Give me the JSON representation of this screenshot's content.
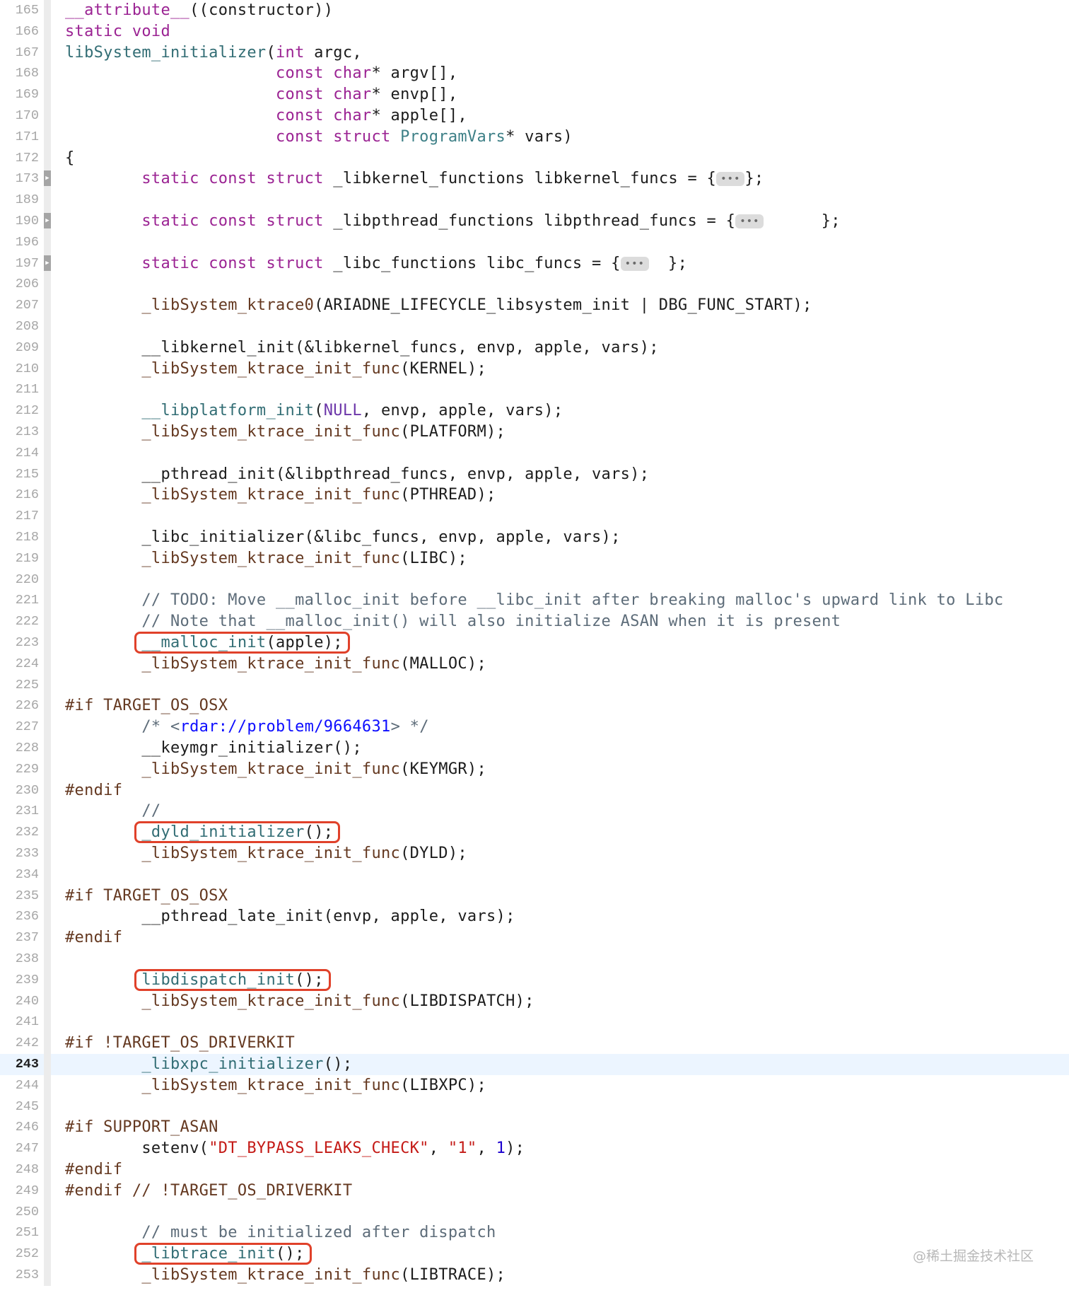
{
  "editor": {
    "current_line": "243",
    "lines": [
      {
        "num": "165",
        "tokens": [
          {
            "t": "__attribute__",
            "c": "k"
          },
          {
            "t": "((constructor))",
            "c": ""
          }
        ]
      },
      {
        "num": "166",
        "tokens": [
          {
            "t": "static void",
            "c": "k"
          }
        ]
      },
      {
        "num": "167",
        "tokens": [
          {
            "t": "libSystem_initializer",
            "c": "f"
          },
          {
            "t": "(",
            "c": ""
          },
          {
            "t": "int",
            "c": "k"
          },
          {
            "t": " argc,",
            "c": ""
          }
        ]
      },
      {
        "num": "168",
        "tokens": [
          {
            "t": "                      ",
            "c": ""
          },
          {
            "t": "const",
            "c": "k"
          },
          {
            "t": " ",
            "c": ""
          },
          {
            "t": "char",
            "c": "k"
          },
          {
            "t": "* argv[],",
            "c": ""
          }
        ]
      },
      {
        "num": "169",
        "tokens": [
          {
            "t": "                      ",
            "c": ""
          },
          {
            "t": "const",
            "c": "k"
          },
          {
            "t": " ",
            "c": ""
          },
          {
            "t": "char",
            "c": "k"
          },
          {
            "t": "* envp[],",
            "c": ""
          }
        ]
      },
      {
        "num": "170",
        "tokens": [
          {
            "t": "                      ",
            "c": ""
          },
          {
            "t": "const",
            "c": "k"
          },
          {
            "t": " ",
            "c": ""
          },
          {
            "t": "char",
            "c": "k"
          },
          {
            "t": "* apple[],",
            "c": ""
          }
        ]
      },
      {
        "num": "171",
        "tokens": [
          {
            "t": "                      ",
            "c": ""
          },
          {
            "t": "const struct",
            "c": "k"
          },
          {
            "t": " ",
            "c": ""
          },
          {
            "t": "ProgramVars",
            "c": "t"
          },
          {
            "t": "* vars)",
            "c": ""
          }
        ]
      },
      {
        "num": "172",
        "tokens": [
          {
            "t": "{",
            "c": ""
          }
        ]
      },
      {
        "num": "173",
        "fold": true,
        "tokens": [
          {
            "t": "        ",
            "c": ""
          },
          {
            "t": "static const struct",
            "c": "k"
          },
          {
            "t": " _libkernel_functions libkernel_funcs = {",
            "c": ""
          },
          {
            "t": "•••",
            "c": "pill"
          },
          {
            "t": "};",
            "c": ""
          }
        ]
      },
      {
        "num": "189",
        "tokens": []
      },
      {
        "num": "190",
        "fold": true,
        "tokens": [
          {
            "t": "        ",
            "c": ""
          },
          {
            "t": "static const struct",
            "c": "k"
          },
          {
            "t": " _libpthread_functions libpthread_funcs = {",
            "c": ""
          },
          {
            "t": "•••",
            "c": "pill"
          },
          {
            "t": "      };",
            "c": ""
          }
        ]
      },
      {
        "num": "196",
        "tokens": []
      },
      {
        "num": "197",
        "fold": true,
        "tokens": [
          {
            "t": "        ",
            "c": ""
          },
          {
            "t": "static const struct",
            "c": "k"
          },
          {
            "t": " _libc_functions libc_funcs = {",
            "c": ""
          },
          {
            "t": "•••",
            "c": "pill"
          },
          {
            "t": "  };",
            "c": ""
          }
        ]
      },
      {
        "num": "206",
        "tokens": []
      },
      {
        "num": "207",
        "tokens": [
          {
            "t": "        ",
            "c": ""
          },
          {
            "t": "_libSystem_ktrace0",
            "c": "mac"
          },
          {
            "t": "(ARIADNE_LIFECYCLE_libsystem_init | DBG_FUNC_START);",
            "c": ""
          }
        ]
      },
      {
        "num": "208",
        "tokens": []
      },
      {
        "num": "209",
        "tokens": [
          {
            "t": "        __libkernel_init(&libkernel_funcs, envp, apple, vars);",
            "c": ""
          }
        ]
      },
      {
        "num": "210",
        "tokens": [
          {
            "t": "        ",
            "c": ""
          },
          {
            "t": "_libSystem_ktrace_init_func",
            "c": "mac"
          },
          {
            "t": "(KERNEL);",
            "c": ""
          }
        ]
      },
      {
        "num": "211",
        "tokens": []
      },
      {
        "num": "212",
        "tokens": [
          {
            "t": "        ",
            "c": ""
          },
          {
            "t": "__libplatform_init",
            "c": "f"
          },
          {
            "t": "(",
            "c": ""
          },
          {
            "t": "NULL",
            "c": "m"
          },
          {
            "t": ", envp, apple, vars);",
            "c": ""
          }
        ]
      },
      {
        "num": "213",
        "tokens": [
          {
            "t": "        ",
            "c": ""
          },
          {
            "t": "_libSystem_ktrace_init_func",
            "c": "mac"
          },
          {
            "t": "(PLATFORM);",
            "c": ""
          }
        ]
      },
      {
        "num": "214",
        "tokens": []
      },
      {
        "num": "215",
        "tokens": [
          {
            "t": "        __pthread_init(&libpthread_funcs, envp, apple, vars);",
            "c": ""
          }
        ]
      },
      {
        "num": "216",
        "tokens": [
          {
            "t": "        ",
            "c": ""
          },
          {
            "t": "_libSystem_ktrace_init_func",
            "c": "mac"
          },
          {
            "t": "(PTHREAD);",
            "c": ""
          }
        ]
      },
      {
        "num": "217",
        "tokens": []
      },
      {
        "num": "218",
        "tokens": [
          {
            "t": "        _libc_initializer(&libc_funcs, envp, apple, vars);",
            "c": ""
          }
        ]
      },
      {
        "num": "219",
        "tokens": [
          {
            "t": "        ",
            "c": ""
          },
          {
            "t": "_libSystem_ktrace_init_func",
            "c": "mac"
          },
          {
            "t": "(LIBC);",
            "c": ""
          }
        ]
      },
      {
        "num": "220",
        "tokens": []
      },
      {
        "num": "221",
        "tokens": [
          {
            "t": "        ",
            "c": ""
          },
          {
            "t": "// TODO: Move __malloc_init before __libc_init after breaking malloc's upward link to Libc",
            "c": "c"
          }
        ]
      },
      {
        "num": "222",
        "tokens": [
          {
            "t": "        ",
            "c": ""
          },
          {
            "t": "// Note that __malloc_init() will also initialize ASAN when it is present",
            "c": "c"
          }
        ]
      },
      {
        "num": "223",
        "tokens": [
          {
            "t": "        ",
            "c": ""
          },
          {
            "t": "__malloc_init",
            "c": "f"
          },
          {
            "t": "(apple);",
            "c": ""
          }
        ]
      },
      {
        "num": "224",
        "tokens": [
          {
            "t": "        ",
            "c": ""
          },
          {
            "t": "_libSystem_ktrace_init_func",
            "c": "mac"
          },
          {
            "t": "(MALLOC);",
            "c": ""
          }
        ]
      },
      {
        "num": "225",
        "tokens": []
      },
      {
        "num": "226",
        "tokens": [
          {
            "t": "#if",
            "c": "pp"
          },
          {
            "t": " TARGET_OS_OSX",
            "c": "pp"
          }
        ]
      },
      {
        "num": "227",
        "tokens": [
          {
            "t": "        ",
            "c": ""
          },
          {
            "t": "/* <",
            "c": "c"
          },
          {
            "t": "rdar://problem/9664631",
            "c": "u"
          },
          {
            "t": "> */",
            "c": "c"
          }
        ]
      },
      {
        "num": "228",
        "tokens": [
          {
            "t": "        __keymgr_initializer();",
            "c": ""
          }
        ]
      },
      {
        "num": "229",
        "tokens": [
          {
            "t": "        ",
            "c": ""
          },
          {
            "t": "_libSystem_ktrace_init_func",
            "c": "mac"
          },
          {
            "t": "(KEYMGR);",
            "c": ""
          }
        ]
      },
      {
        "num": "230",
        "tokens": [
          {
            "t": "#endif",
            "c": "pp"
          }
        ]
      },
      {
        "num": "231",
        "tokens": [
          {
            "t": "        ",
            "c": ""
          },
          {
            "t": "//",
            "c": "c"
          }
        ]
      },
      {
        "num": "232",
        "tokens": [
          {
            "t": "        ",
            "c": ""
          },
          {
            "t": "_dyld_initializer",
            "c": "f"
          },
          {
            "t": "();",
            "c": ""
          }
        ]
      },
      {
        "num": "233",
        "tokens": [
          {
            "t": "        ",
            "c": ""
          },
          {
            "t": "_libSystem_ktrace_init_func",
            "c": "mac"
          },
          {
            "t": "(DYLD);",
            "c": ""
          }
        ]
      },
      {
        "num": "234",
        "tokens": []
      },
      {
        "num": "235",
        "tokens": [
          {
            "t": "#if",
            "c": "pp"
          },
          {
            "t": " TARGET_OS_OSX",
            "c": "pp"
          }
        ]
      },
      {
        "num": "236",
        "tokens": [
          {
            "t": "        __pthread_late_init(envp, apple, vars);",
            "c": ""
          }
        ]
      },
      {
        "num": "237",
        "tokens": [
          {
            "t": "#endif",
            "c": "pp"
          }
        ]
      },
      {
        "num": "238",
        "tokens": []
      },
      {
        "num": "239",
        "tokens": [
          {
            "t": "        ",
            "c": ""
          },
          {
            "t": "libdispatch_init",
            "c": "f"
          },
          {
            "t": "();",
            "c": ""
          }
        ]
      },
      {
        "num": "240",
        "tokens": [
          {
            "t": "        ",
            "c": ""
          },
          {
            "t": "_libSystem_ktrace_init_func",
            "c": "mac"
          },
          {
            "t": "(LIBDISPATCH);",
            "c": ""
          }
        ]
      },
      {
        "num": "241",
        "tokens": []
      },
      {
        "num": "242",
        "tokens": [
          {
            "t": "#if",
            "c": "pp"
          },
          {
            "t": " !TARGET_OS_DRIVERKIT",
            "c": "pp"
          }
        ]
      },
      {
        "num": "243",
        "tokens": [
          {
            "t": "        ",
            "c": ""
          },
          {
            "t": "_libxpc_initializer",
            "c": "f"
          },
          {
            "t": "();",
            "c": ""
          }
        ]
      },
      {
        "num": "244",
        "tokens": [
          {
            "t": "        ",
            "c": ""
          },
          {
            "t": "_libSystem_ktrace_init_func",
            "c": "mac"
          },
          {
            "t": "(LIBXPC);",
            "c": ""
          }
        ]
      },
      {
        "num": "245",
        "tokens": []
      },
      {
        "num": "246",
        "tokens": [
          {
            "t": "#if",
            "c": "pp"
          },
          {
            "t": " SUPPORT_ASAN",
            "c": "pp"
          }
        ]
      },
      {
        "num": "247",
        "tokens": [
          {
            "t": "        setenv(",
            "c": ""
          },
          {
            "t": "\"DT_BYPASS_LEAKS_CHECK\"",
            "c": "s"
          },
          {
            "t": ", ",
            "c": ""
          },
          {
            "t": "\"1\"",
            "c": "s"
          },
          {
            "t": ", ",
            "c": ""
          },
          {
            "t": "1",
            "c": "n"
          },
          {
            "t": ");",
            "c": ""
          }
        ]
      },
      {
        "num": "248",
        "tokens": [
          {
            "t": "#endif",
            "c": "pp"
          }
        ]
      },
      {
        "num": "249",
        "tokens": [
          {
            "t": "#endif",
            "c": "pp"
          },
          {
            "t": " // !TARGET_OS_DRIVERKIT",
            "c": "pp"
          }
        ]
      },
      {
        "num": "250",
        "tokens": []
      },
      {
        "num": "251",
        "tokens": [
          {
            "t": "        ",
            "c": ""
          },
          {
            "t": "// must be initialized after dispatch",
            "c": "c"
          }
        ]
      },
      {
        "num": "252",
        "tokens": [
          {
            "t": "        ",
            "c": ""
          },
          {
            "t": "_libtrace_init",
            "c": "f"
          },
          {
            "t": "();",
            "c": ""
          }
        ]
      },
      {
        "num": "253",
        "tokens": [
          {
            "t": "        ",
            "c": ""
          },
          {
            "t": "_libSystem_ktrace_init_func",
            "c": "mac"
          },
          {
            "t": "(LIBTRACE);",
            "c": ""
          }
        ]
      }
    ]
  },
  "highlights": [
    {
      "line": "223",
      "label": "__malloc_init(apple);"
    },
    {
      "line": "232",
      "label": "_dyld_initializer();"
    },
    {
      "line": "239",
      "label": "libdispatch_init();"
    },
    {
      "line": "252",
      "label": "_libtrace_init();"
    }
  ],
  "watermark": "@稀土掘金技术社区",
  "colors": {
    "keyword": "#9b2393",
    "function": "#326d74",
    "comment": "#5d6c79",
    "string": "#c41a16",
    "number": "#1c00cf",
    "preprocessor": "#643820",
    "highlight_border": "#e0412a",
    "current_line_bg": "#ecf5ff"
  }
}
